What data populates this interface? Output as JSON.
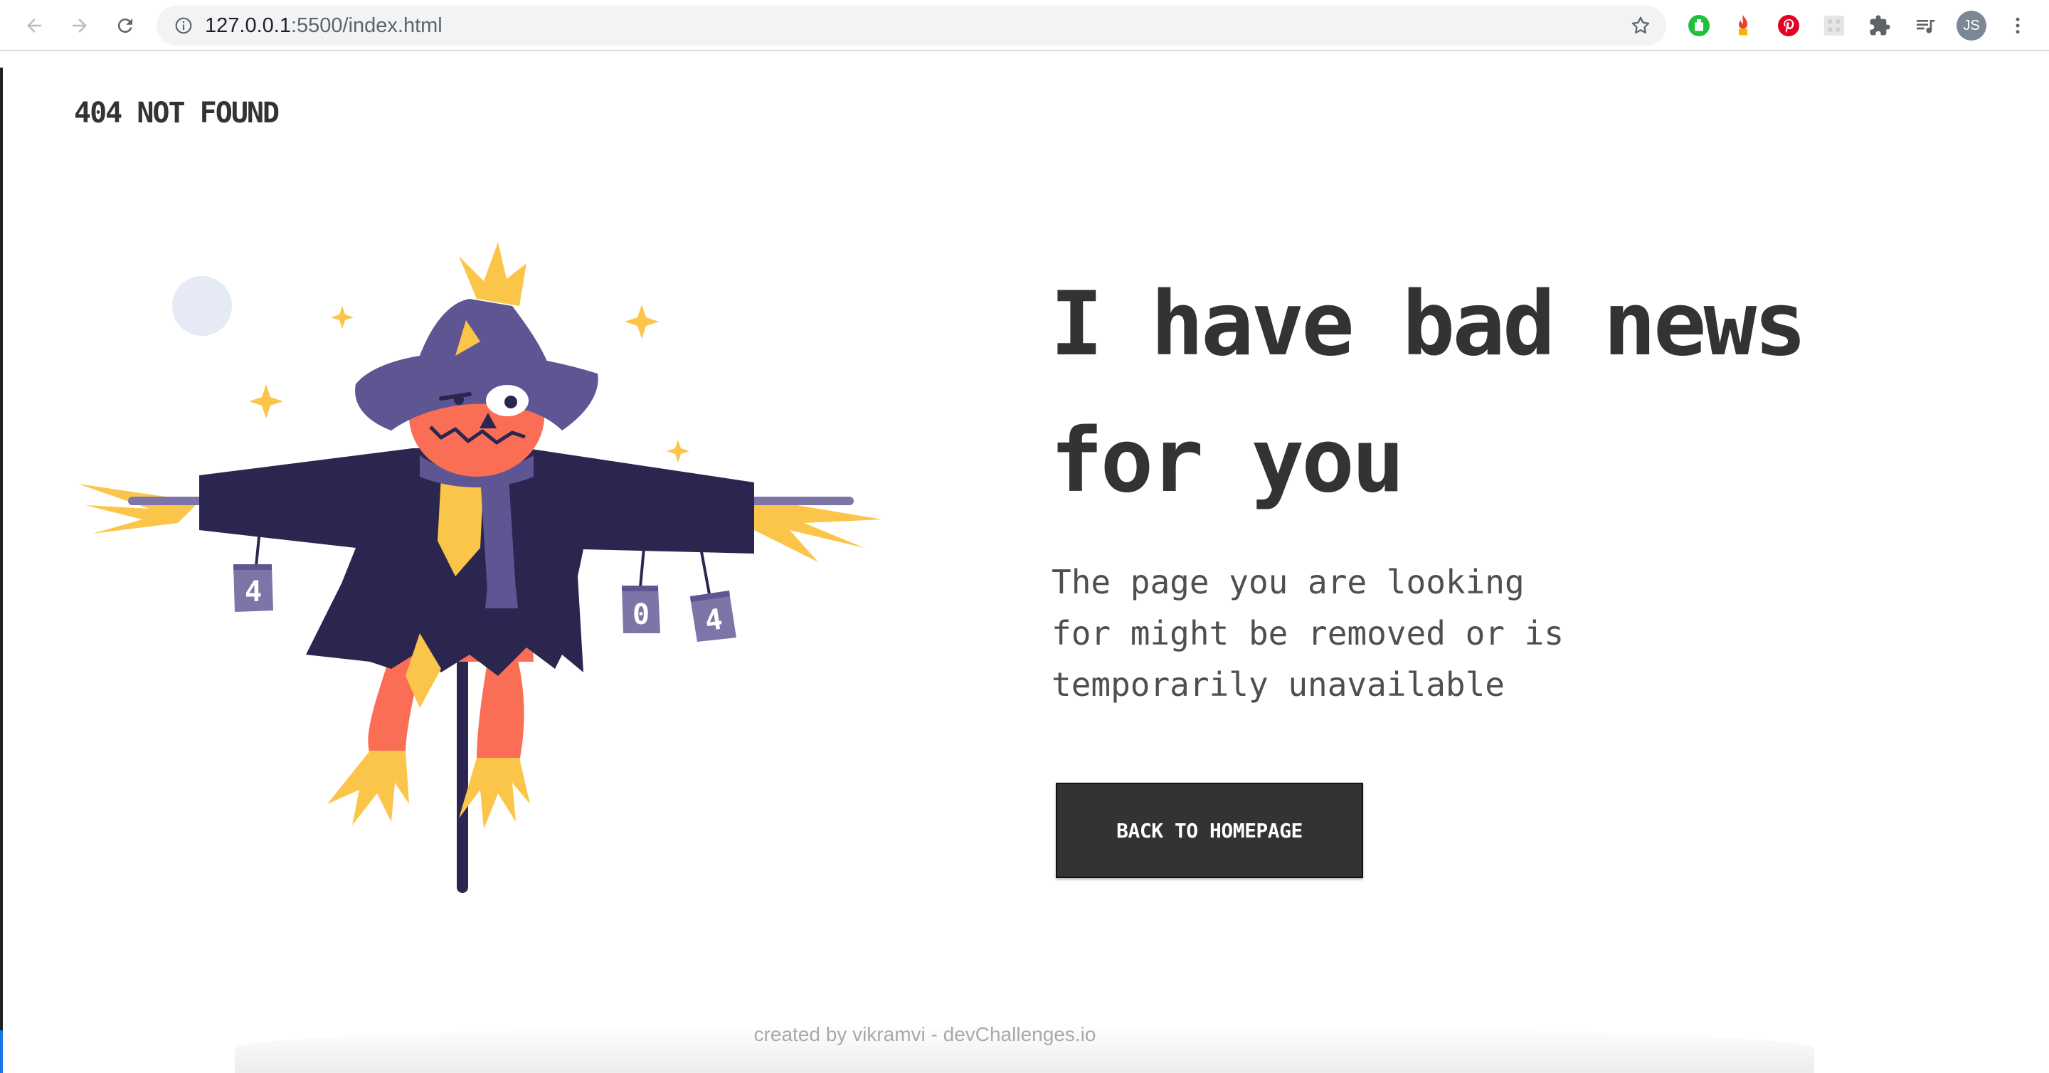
{
  "browser": {
    "url_host": "127.0.0.1",
    "url_rest": ":5500/index.html",
    "profile_initials": "JS"
  },
  "page": {
    "logo": "404 NOT FOUND",
    "headline_line1": "I have bad news",
    "headline_line2": "for you",
    "subtext_line1": "The page you are looking",
    "subtext_line2": "for might be removed or is",
    "subtext_line3": "temporarily unavailable",
    "button_label": "BACK TO HOMEPAGE",
    "footer": "created by vikramvi - devChallenges.io"
  },
  "illustration": {
    "can_labels": [
      "4",
      "0",
      "4"
    ]
  },
  "colors": {
    "text": "#333333",
    "subtext": "#4f4f4f",
    "button_bg": "#333333",
    "scarecrow_coat": "#2b2650",
    "scarecrow_face": "#fa6e55",
    "straw": "#fbc54a",
    "hat": "#5e5593",
    "moon": "#e6eaf4"
  }
}
